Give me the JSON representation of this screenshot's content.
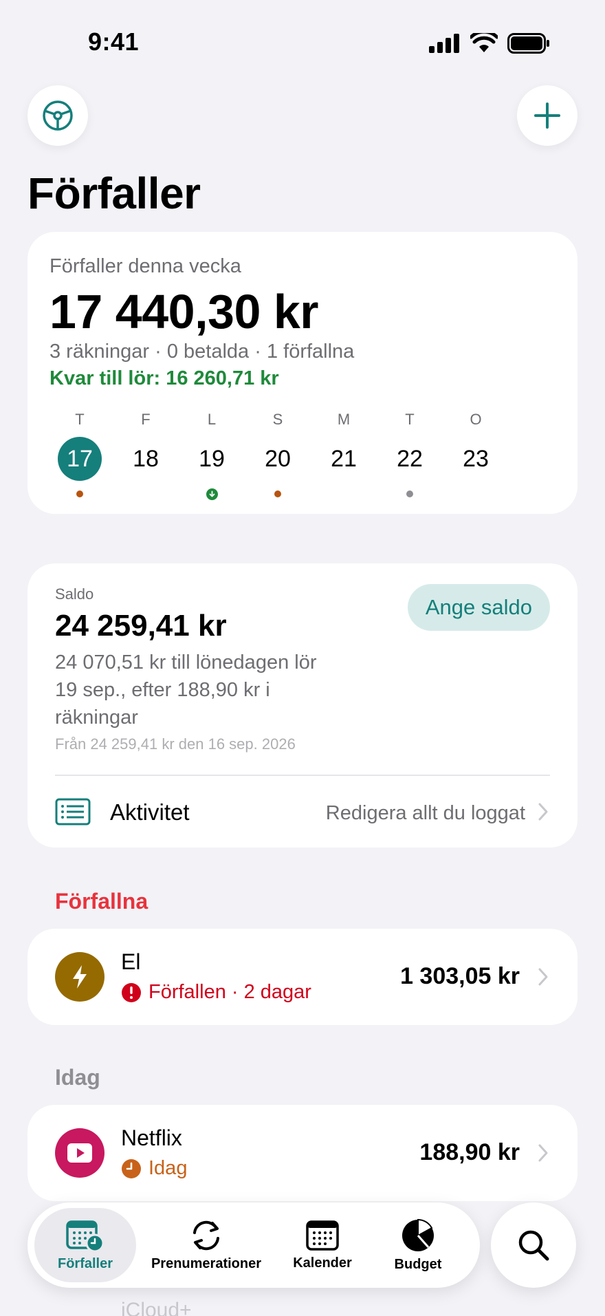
{
  "status_bar": {
    "time": "9:41"
  },
  "header": {
    "title": "Förfaller"
  },
  "week_card": {
    "caption": "Förfaller denna vecka",
    "total": "17 440,30 kr",
    "summary": "3 räkningar · 0 betalda · 1 förfallna",
    "remaining": "Kvar till lör: 16 260,71 kr",
    "days": [
      {
        "letter": "T",
        "number": "17",
        "selected": true,
        "marker": "orange-dot"
      },
      {
        "letter": "F",
        "number": "18",
        "selected": false,
        "marker": "none"
      },
      {
        "letter": "L",
        "number": "19",
        "selected": false,
        "marker": "green-payday-icon"
      },
      {
        "letter": "S",
        "number": "20",
        "selected": false,
        "marker": "orange-dot"
      },
      {
        "letter": "M",
        "number": "21",
        "selected": false,
        "marker": "none"
      },
      {
        "letter": "T",
        "number": "22",
        "selected": false,
        "marker": "grey-dot"
      },
      {
        "letter": "O",
        "number": "23",
        "selected": false,
        "marker": "none"
      }
    ]
  },
  "balance_card": {
    "label": "Saldo",
    "amount": "24 259,41 kr",
    "description": "24 070,51 kr till lönedagen lör 19 sep., efter 188,90 kr i räkningar",
    "from_note": "Från 24 259,41 kr den 16 sep. 2026",
    "set_button": "Ange saldo",
    "activity": {
      "label": "Aktivitet",
      "hint": "Redigera allt du loggat"
    }
  },
  "sections": {
    "overdue": {
      "title": "Förfallna",
      "bill": {
        "name": "El",
        "status": "Förfallen · 2 dagar",
        "amount": "1 303,05 kr",
        "icon": "lightning-icon",
        "icon_color": "#956a00"
      }
    },
    "today": {
      "title": "Idag",
      "bill": {
        "name": "Netflix",
        "status": "Idag",
        "amount": "188,90 kr",
        "icon": "play-icon",
        "icon_color": "#c8185f"
      }
    },
    "next_peek": "iCloud+"
  },
  "tab_bar": {
    "tabs": [
      {
        "label": "Förfaller",
        "icon": "calendar-clock-icon",
        "active": true
      },
      {
        "label": "Prenumerationer",
        "icon": "refresh-icon",
        "active": false
      },
      {
        "label": "Kalender",
        "icon": "calendar-icon",
        "active": false
      },
      {
        "label": "Budget",
        "icon": "pie-chart-icon",
        "active": false
      }
    ],
    "search_icon": "search-icon"
  },
  "colors": {
    "accent": "#157f7b",
    "positive": "#1f8a3b",
    "overdue": "#e8333d",
    "due_today": "#c8621a",
    "background": "#f2f2f7"
  }
}
